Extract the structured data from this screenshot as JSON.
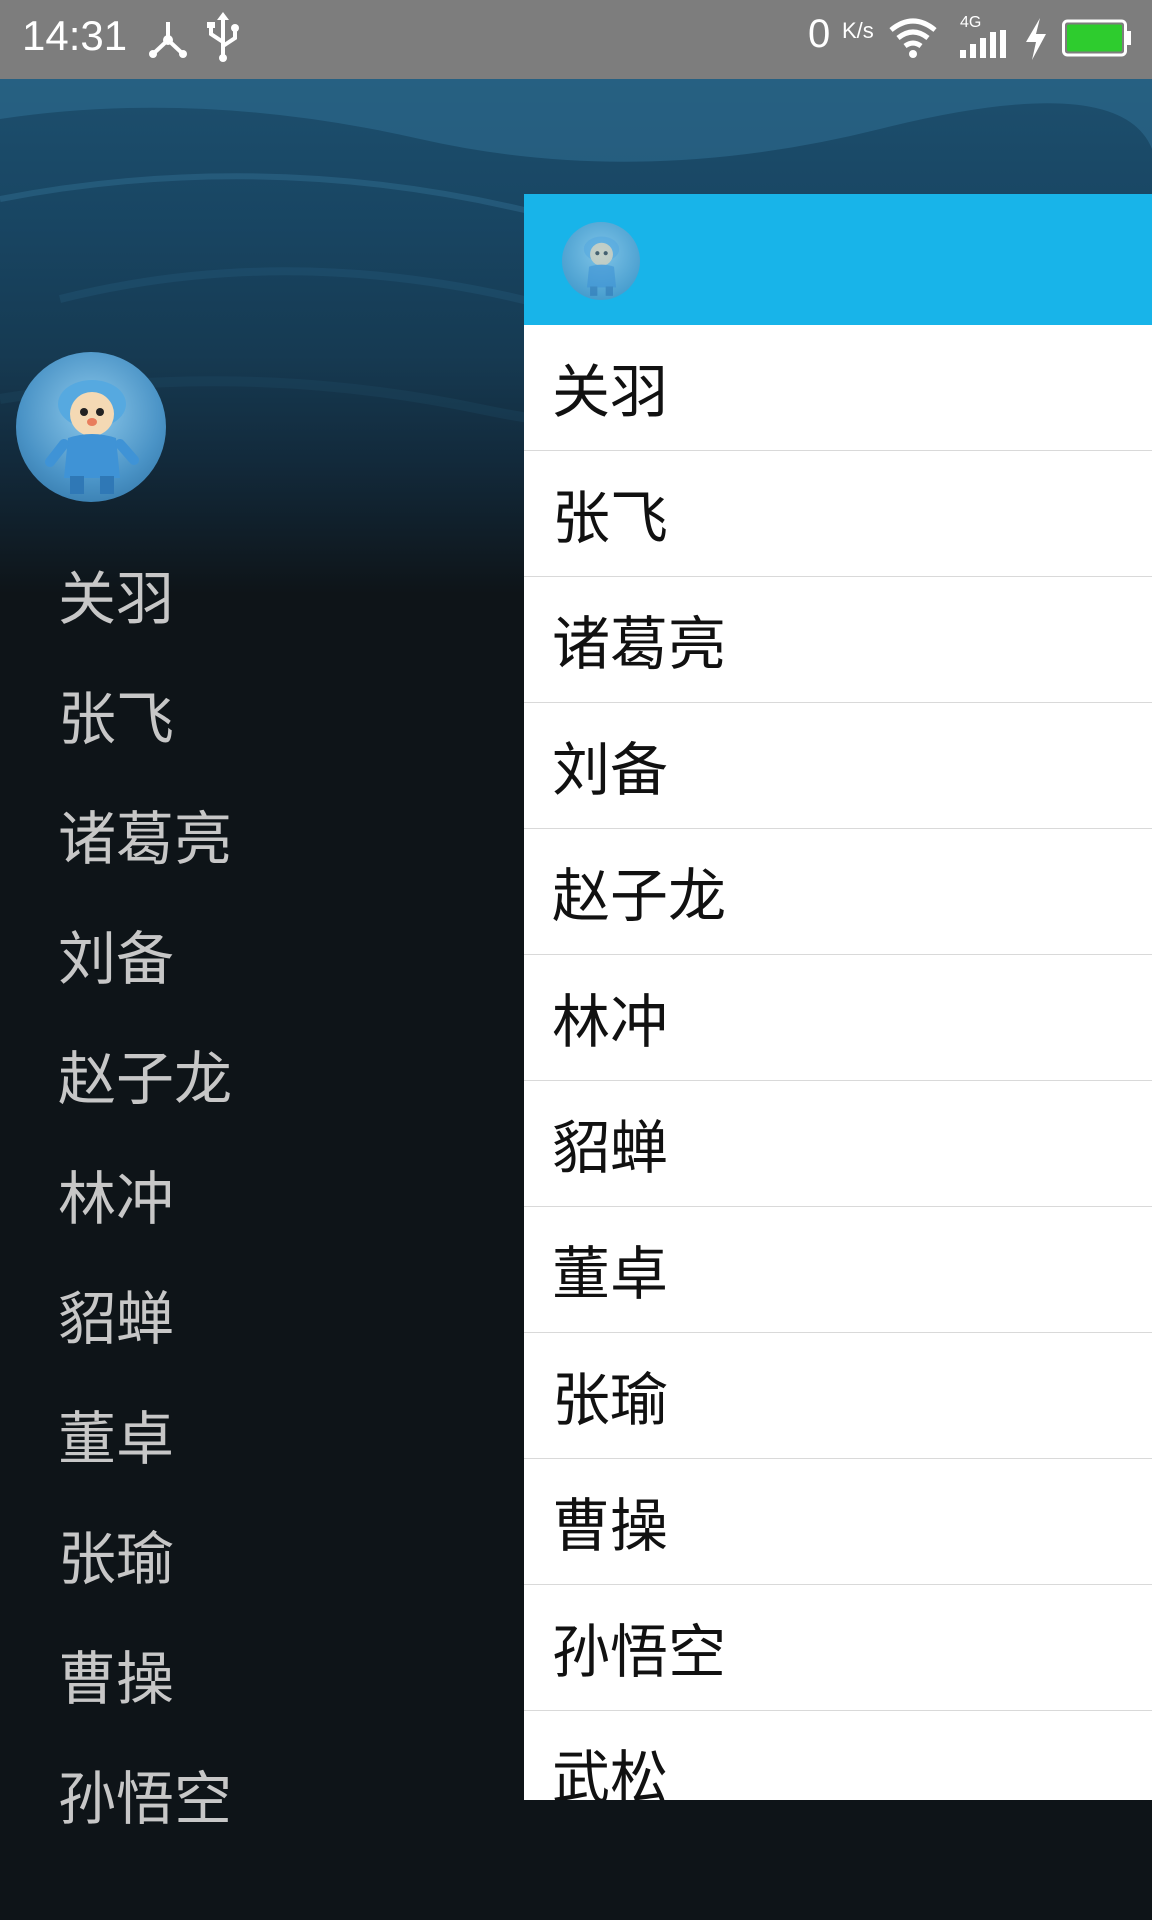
{
  "status_bar": {
    "time": "14:31",
    "net_speed": "0",
    "net_speed_unit": "K/s",
    "network_label": "4G",
    "icons": [
      "usb-share-icon",
      "usb-icon",
      "wifi-icon",
      "signal-4g-icon",
      "charging-icon",
      "battery-icon"
    ],
    "battery_color": "#2ecc2e"
  },
  "drawer": {
    "avatar_icon": "pocoyo-avatar",
    "items": [
      {
        "label": "关羽"
      },
      {
        "label": "张飞"
      },
      {
        "label": "诸葛亮"
      },
      {
        "label": "刘备"
      },
      {
        "label": "赵子龙"
      },
      {
        "label": "林冲"
      },
      {
        "label": "貂蝉"
      },
      {
        "label": "董卓"
      },
      {
        "label": "张瑜"
      },
      {
        "label": "曹操"
      },
      {
        "label": "孙悟空"
      }
    ]
  },
  "main": {
    "toolbar_color": "#18b4e9",
    "toolbar_avatar_icon": "pocoyo-avatar",
    "items": [
      {
        "label": "关羽"
      },
      {
        "label": "张飞"
      },
      {
        "label": "诸葛亮"
      },
      {
        "label": "刘备"
      },
      {
        "label": "赵子龙"
      },
      {
        "label": "林冲"
      },
      {
        "label": "貂蝉"
      },
      {
        "label": "董卓"
      },
      {
        "label": "张瑜"
      },
      {
        "label": "曹操"
      },
      {
        "label": "孙悟空"
      },
      {
        "label": "武松"
      }
    ]
  }
}
